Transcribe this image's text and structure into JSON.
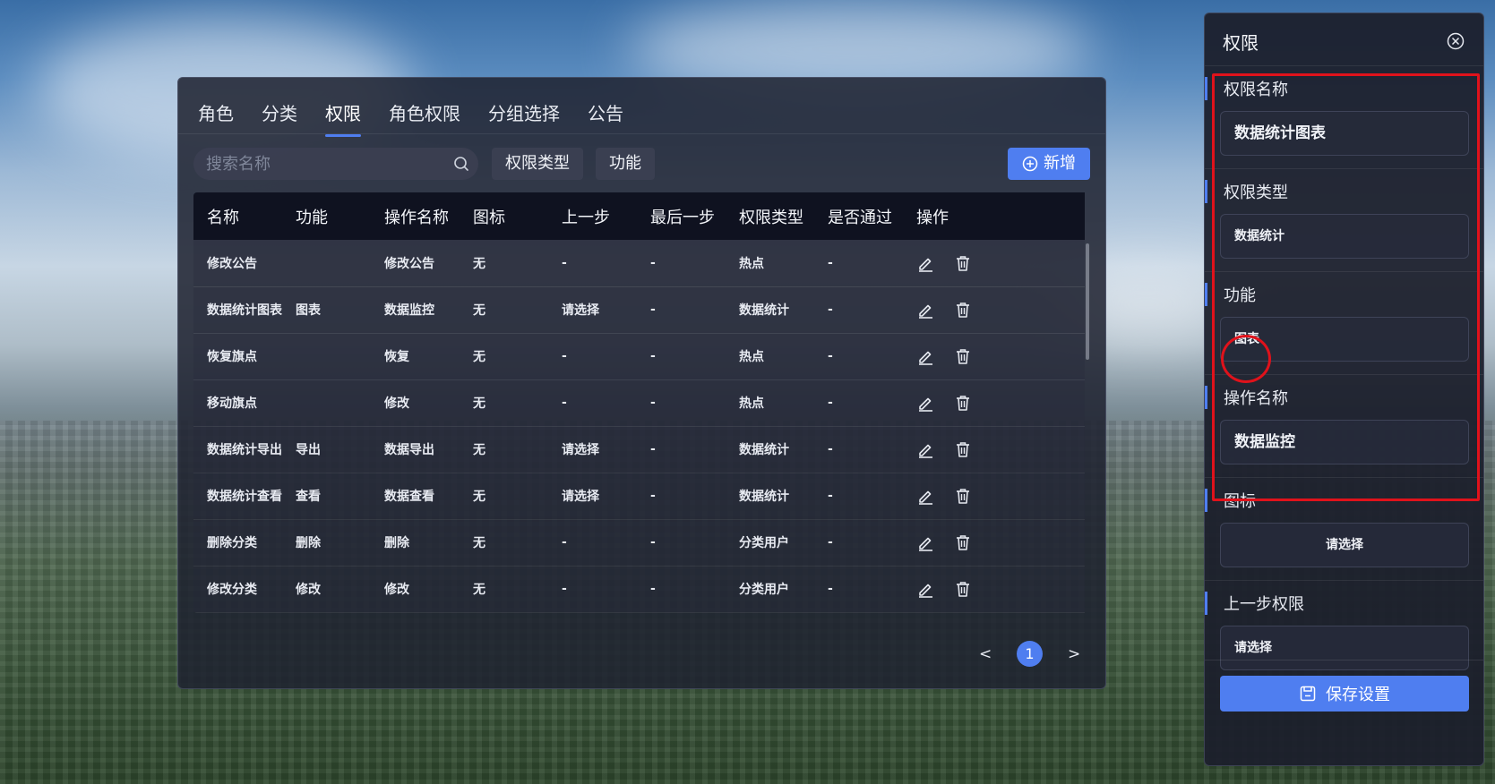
{
  "tabs": [
    "角色",
    "分类",
    "权限",
    "角色权限",
    "分组选择",
    "公告"
  ],
  "active_tab_index": 2,
  "search": {
    "placeholder": "搜索名称"
  },
  "filters": {
    "type_label": "权限类型",
    "function_label": "功能"
  },
  "add_button": {
    "label": "新增"
  },
  "table": {
    "headers": [
      "名称",
      "功能",
      "操作名称",
      "图标",
      "上一步",
      "最后一步",
      "权限类型",
      "是否通过",
      "操作"
    ],
    "rows": [
      [
        "修改公告",
        "",
        "修改公告",
        "无",
        "-",
        "-",
        "热点",
        "-"
      ],
      [
        "数据统计图表",
        "图表",
        "数据监控",
        "无",
        "请选择",
        "-",
        "数据统计",
        "-"
      ],
      [
        "恢复旗点",
        "",
        "恢复",
        "无",
        "-",
        "-",
        "热点",
        "-"
      ],
      [
        "移动旗点",
        "",
        "修改",
        "无",
        "-",
        "-",
        "热点",
        "-"
      ],
      [
        "数据统计导出",
        "导出",
        "数据导出",
        "无",
        "请选择",
        "-",
        "数据统计",
        "-"
      ],
      [
        "数据统计查看",
        "查看",
        "数据查看",
        "无",
        "请选择",
        "-",
        "数据统计",
        "-"
      ],
      [
        "删除分类",
        "删除",
        "删除",
        "无",
        "-",
        "-",
        "分类用户",
        "-"
      ],
      [
        "修改分类",
        "修改",
        "修改",
        "无",
        "-",
        "-",
        "分类用户",
        "-"
      ]
    ]
  },
  "pagination": {
    "prev": "<",
    "current": "1",
    "next": ">"
  },
  "side_panel": {
    "title": "权限",
    "fields": [
      {
        "label": "权限名称",
        "value": "数据统计图表"
      },
      {
        "label": "权限类型",
        "value": "数据统计"
      },
      {
        "label": "功能",
        "value": "图表"
      },
      {
        "label": "操作名称",
        "value": "数据监控"
      },
      {
        "label": "图标",
        "value": "请选择"
      },
      {
        "label": "上一步权限",
        "value": "请选择"
      }
    ],
    "save_label": "保存设置"
  },
  "colors": {
    "accent": "#4f7ef0",
    "annotation": "#e0121b",
    "panel": "#1e2230"
  }
}
